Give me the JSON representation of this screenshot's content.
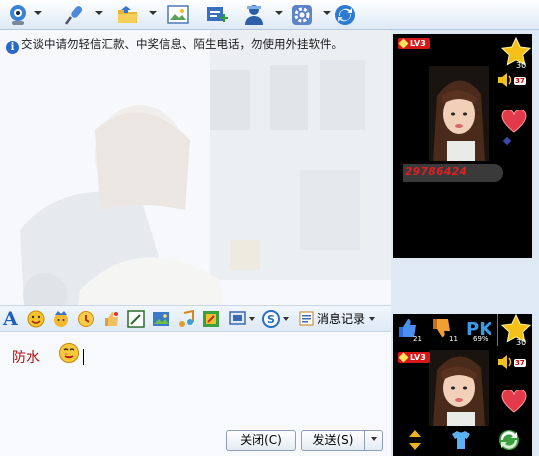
{
  "toolbar": {
    "icons": [
      "webcam-icon",
      "microphone-icon",
      "folder-icon",
      "picture-icon",
      "chat-add-icon",
      "member-icon",
      "settings-icon",
      "refresh-app-icon"
    ]
  },
  "notice": {
    "icon": "info-icon",
    "text": "交谈中请勿轻信汇款、中奖信息、陌生电话，勿使用外挂软件。"
  },
  "format_bar": {
    "font_icon_glyph": "A",
    "icons": [
      "font-icon",
      "smiley-icon",
      "magic-face-icon",
      "send-face-icon",
      "thumb-icon",
      "screenshot-icon",
      "music-icon",
      "game-icon",
      "apps-icon",
      "s-icon"
    ],
    "history_label": "消息记录"
  },
  "input": {
    "text": "防水"
  },
  "buttons": {
    "close_label": "关闭(C)",
    "send_label": "发送(S)"
  },
  "show_top": {
    "level": "LV3",
    "star_count": "30",
    "speaker_count": "37",
    "user_id": "29786424"
  },
  "show_bottom": {
    "likes": "21",
    "dislikes": "11",
    "pk_percent": "69%",
    "level": "LV3",
    "star_count": "30",
    "speaker_count": "37"
  },
  "colors": {
    "accent": "#1f5fb8",
    "input_text": "#b01010",
    "badge_red": "#d81818",
    "panel_bg": "#000000"
  }
}
